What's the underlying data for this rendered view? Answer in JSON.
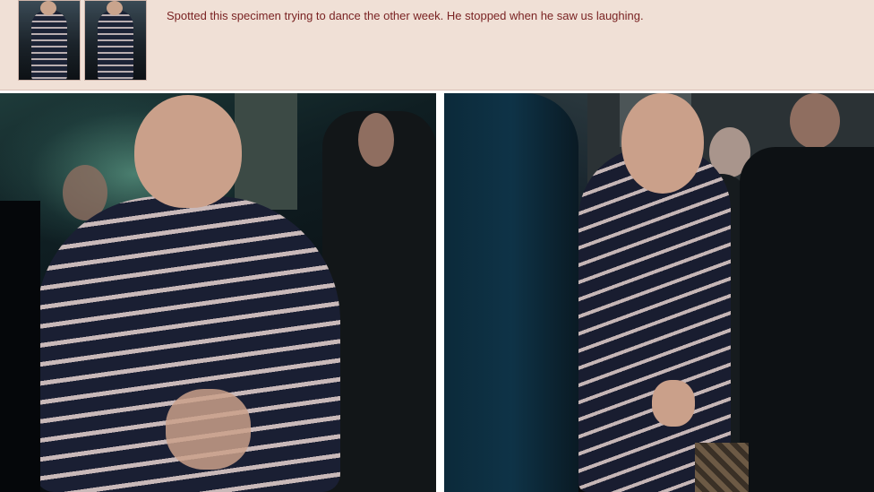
{
  "post": {
    "comment": "Spotted this specimen trying to dance the other week. He stopped when he saw us laughing."
  },
  "thumbnails": [
    "thumbnail-left",
    "thumbnail-right"
  ],
  "photos": [
    "photo-left",
    "photo-right"
  ]
}
